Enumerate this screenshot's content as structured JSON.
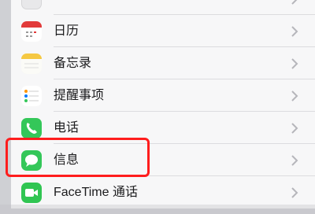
{
  "settings_list": {
    "items": [
      {
        "key": "top",
        "label": ""
      },
      {
        "key": "calendar",
        "label": "日历"
      },
      {
        "key": "notes",
        "label": "备忘录"
      },
      {
        "key": "reminders",
        "label": "提醒事项"
      },
      {
        "key": "phone",
        "label": "电话"
      },
      {
        "key": "messages",
        "label": "信息"
      },
      {
        "key": "facetime",
        "label": "FaceTime 通话"
      }
    ]
  },
  "icons": {
    "calendar": "calendar-icon",
    "notes": "notes-icon",
    "reminders": "reminders-icon",
    "phone": "phone-icon",
    "messages": "messages-icon",
    "facetime": "facetime-icon",
    "chevron": "chevron-right-icon"
  },
  "colors": {
    "highlight": "#ff1d1d",
    "phone_green": "#34c759",
    "messages_green": "#34c759",
    "facetime_green": "#30c552",
    "calendar_red": "#e23a3a",
    "notes_yellow": "#f5c842"
  },
  "selected_item": "messages"
}
